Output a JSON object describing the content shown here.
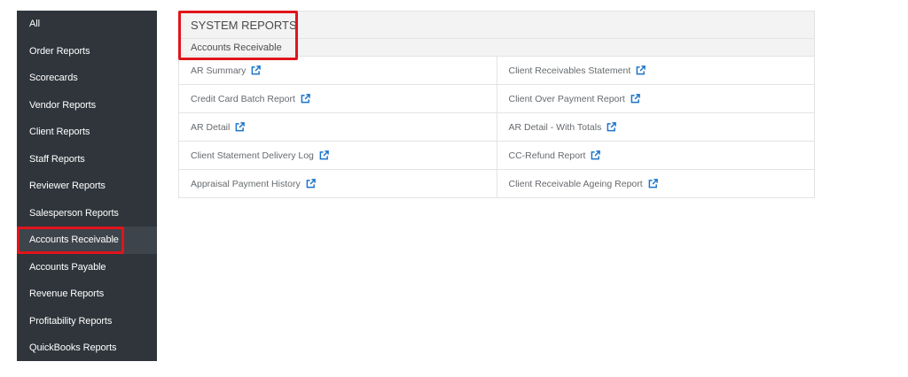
{
  "sidebar": {
    "items": [
      {
        "label": "All"
      },
      {
        "label": "Order Reports"
      },
      {
        "label": "Scorecards"
      },
      {
        "label": "Vendor Reports"
      },
      {
        "label": "Client Reports"
      },
      {
        "label": "Staff Reports"
      },
      {
        "label": "Reviewer Reports"
      },
      {
        "label": "Salesperson Reports"
      },
      {
        "label": "Accounts Receivable",
        "active": true
      },
      {
        "label": "Accounts Payable"
      },
      {
        "label": "Revenue Reports"
      },
      {
        "label": "Profitability Reports"
      },
      {
        "label": "QuickBooks Reports"
      }
    ]
  },
  "panel": {
    "title": "SYSTEM REPORTS",
    "subtitle": "Accounts Receivable",
    "rows": [
      [
        "AR Summary",
        "Client Receivables Statement"
      ],
      [
        "Credit Card Batch Report",
        "Client Over Payment Report"
      ],
      [
        "AR Detail",
        "AR Detail - With Totals"
      ],
      [
        "Client Statement Delivery Log",
        "CC-Refund Report"
      ],
      [
        "Appraisal Payment History",
        "Client Receivable Ageing Report"
      ]
    ],
    "link_icon": "external-link-icon"
  },
  "colors": {
    "sidebar_bg": "#2f353b",
    "sidebar_active_bg": "#3e444b",
    "highlight": "#e0151b",
    "link_icon": "#1a73c9"
  }
}
